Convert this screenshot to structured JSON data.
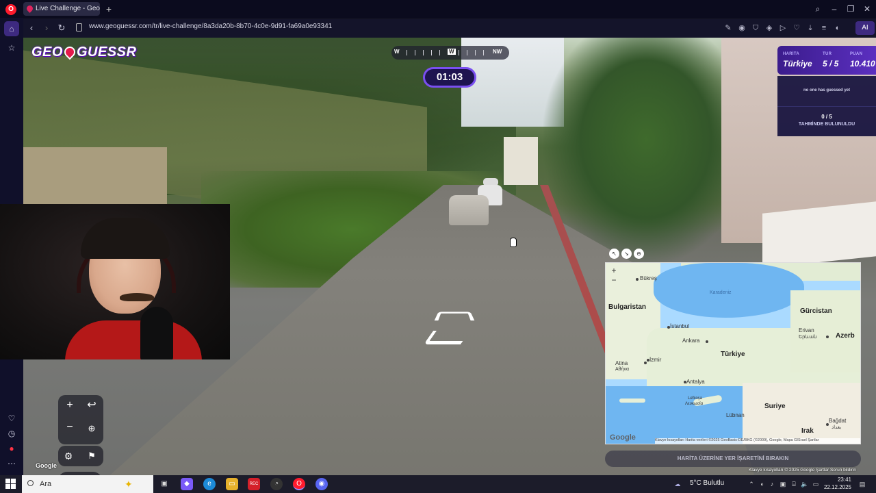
{
  "browser": {
    "tab_title": "Live Challenge - GeoGues",
    "url": "www.geoguessr.com/tr/live-challenge/8a3da20b-8b70-4c0e-9d91-fa69a0e93341",
    "ai_label": "AI"
  },
  "game": {
    "logo": "GEOGUESSR",
    "compass": {
      "left": "W",
      "center": "W",
      "right": "NW"
    },
    "timer": "01:03",
    "hud": {
      "map_label": "HARİTA",
      "map_value": "Türkiye",
      "round_label": "TUR",
      "round_value": "5 / 5",
      "score_label": "PUAN",
      "score_value": "10.410",
      "no_guess": "no one has guessed yet",
      "guess_count": "0 / 5",
      "guess_count_label": "TAHMİNDE BULUNULDU"
    },
    "guess_button": "HARİTA ÜZERİNE YER İŞARETİNİ BIRAKIN",
    "google_watermark": "Google",
    "sv_attribution": "Klavye kısayolları  © 2025 Google  Şartlar  Sorun bildirin"
  },
  "map": {
    "labels": {
      "bukres": "Bükreş",
      "karadeniz": "Karadeniz",
      "bulgaristan": "Bulgaristan",
      "gurcistan": "Gürcistan",
      "istanbul": "İstanbul",
      "ankara": "Ankara",
      "erivan": "Erivan",
      "erivan_native": "Երևան",
      "azer": "Azerb",
      "turkiye": "Türkiye",
      "atina": "Atina",
      "atina_native": "Αθήνα",
      "izmir": "İzmir",
      "antalya": "Antalya",
      "lefkosa": "Lefkoşa",
      "lefkosa_native": "Λευκωσία",
      "suriye": "Suriye",
      "lubnan": "Lübnan",
      "bagdat": "Bağdat",
      "bagdat_native": "بغداد",
      "irak": "Irak"
    },
    "google": "Google",
    "attribution": "Klavye kısayolları    Harita verileri ©2025 GeoBasis-DE/BKG (©2009), Google, Mapa GISrael    Şartlar"
  },
  "taskbar": {
    "search_placeholder": "Ara",
    "weather": "5°C  Bulutlu",
    "time": "23:41",
    "date": "22.12.2025"
  },
  "colors": {
    "accent": "#7a4ff0",
    "hud_bg": "#3b1c8c",
    "brand_pin": "#e4194b"
  }
}
